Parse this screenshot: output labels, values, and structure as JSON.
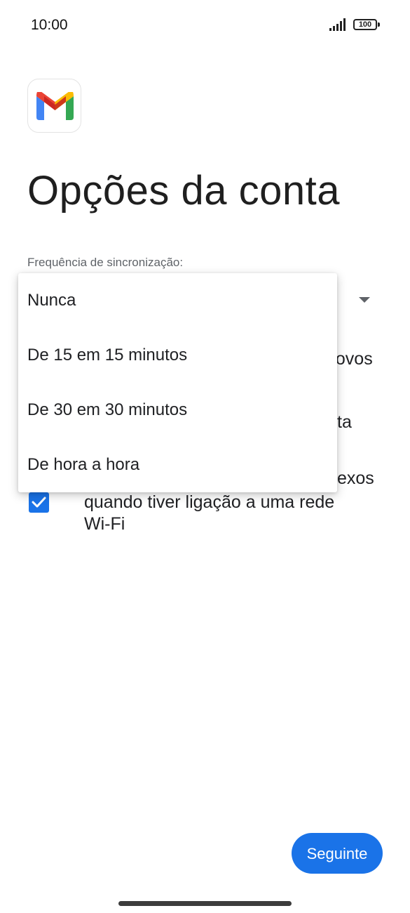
{
  "status_bar": {
    "time": "10:00",
    "battery": "100"
  },
  "header": {
    "app_icon": "gmail-logo",
    "title": "Opções da conta"
  },
  "sync": {
    "label": "Frequência de sincronização:",
    "options": [
      "Nunca",
      "De 15 em 15 minutos",
      "De 30 em 30 minutos",
      "De hora a hora"
    ]
  },
  "background_options": {
    "fragment_1": "novos",
    "fragment_2": "ta",
    "fragment_3": "exos",
    "wifi_option_line_1": "quando tiver ligação a uma rede",
    "wifi_option_line_2": "Wi-Fi",
    "wifi_checked": true
  },
  "footer": {
    "next_label": "Seguinte"
  },
  "colors": {
    "accent": "#1a73e8",
    "title": "#1f1f1f"
  }
}
